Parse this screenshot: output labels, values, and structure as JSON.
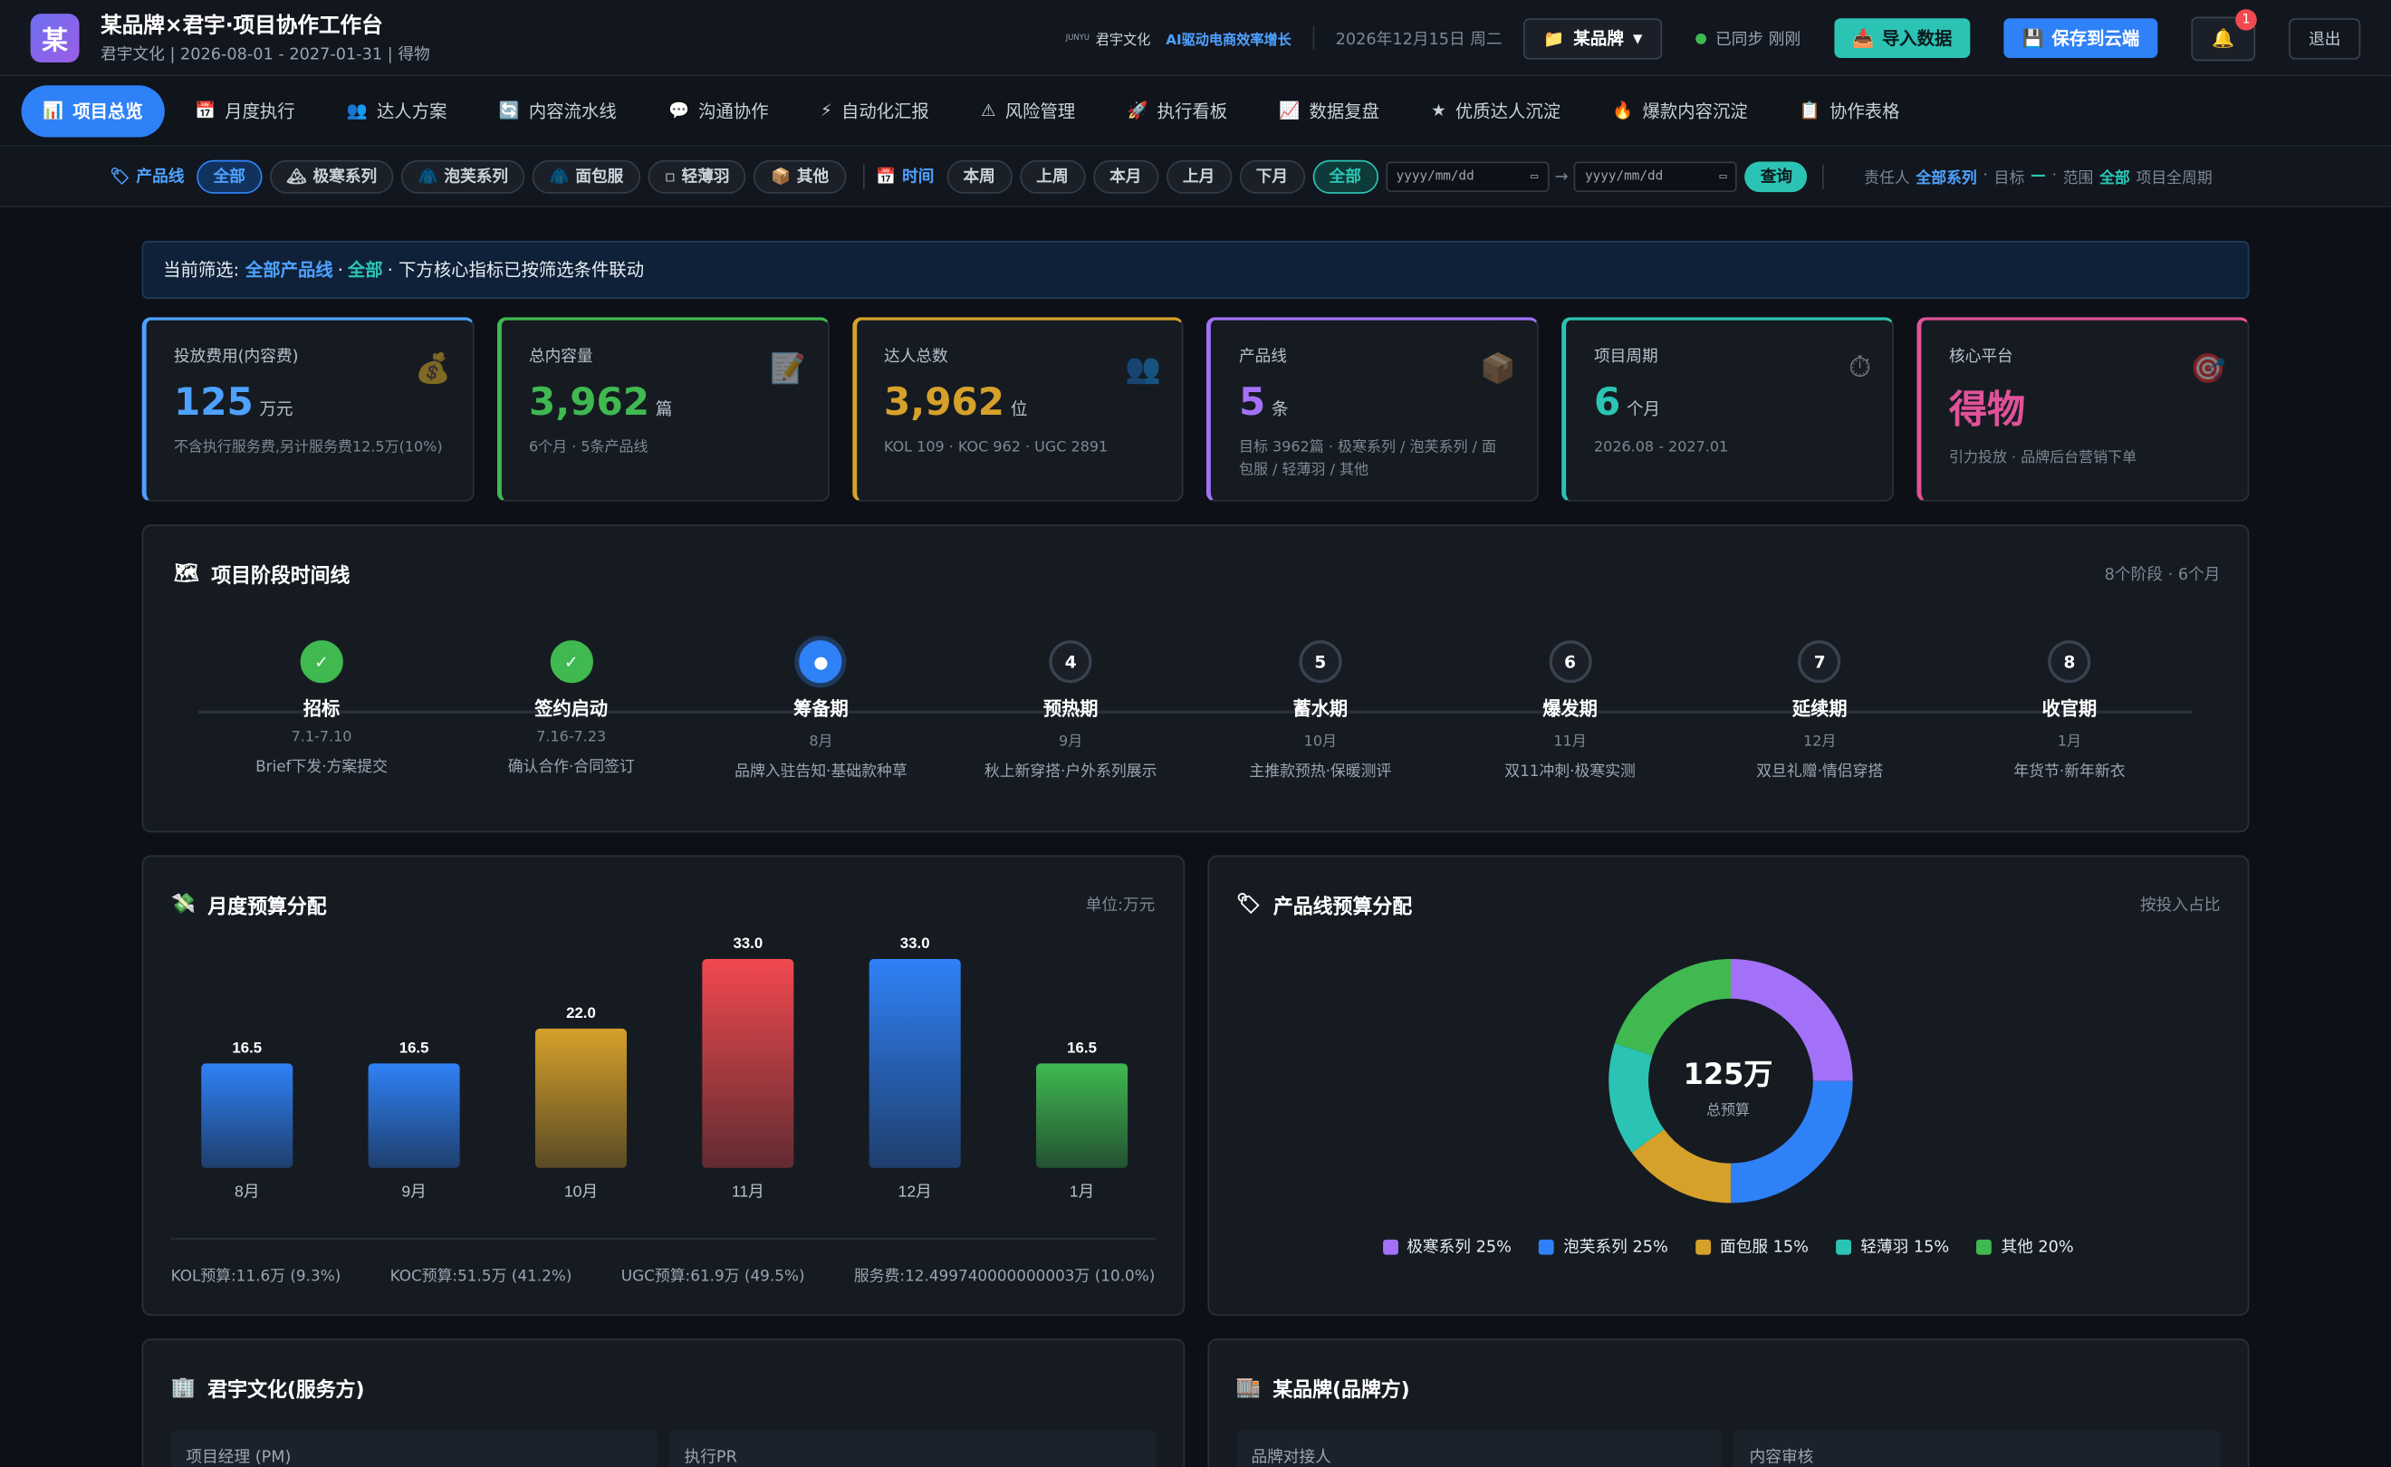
{
  "app": {
    "logo_char": "某",
    "title": "某品牌×君宇·项目协作工作台",
    "subtitle": "君宇文化 | 2026-08-01 - 2027-01-31 | 得物"
  },
  "topbar": {
    "brand_tiny": "JUNYU",
    "company": "君宇文化",
    "slogan": "AI驱动电商效率增长",
    "date": "2026年12月15日 周二",
    "brand_select": "某品牌",
    "sync_status": "已同步 刚刚",
    "import_label": "导入数据",
    "save_label": "保存到云端",
    "notif_count": "1",
    "logout_label": "退出"
  },
  "nav": {
    "items": [
      {
        "icon": "📊",
        "label": "项目总览"
      },
      {
        "icon": "📅",
        "label": "月度执行"
      },
      {
        "icon": "👥",
        "label": "达人方案"
      },
      {
        "icon": "🔄",
        "label": "内容流水线"
      },
      {
        "icon": "💬",
        "label": "沟通协作"
      },
      {
        "icon": "⚡",
        "label": "自动化汇报"
      },
      {
        "icon": "⚠",
        "label": "风险管理"
      },
      {
        "icon": "🚀",
        "label": "执行看板"
      },
      {
        "icon": "📈",
        "label": "数据复盘"
      },
      {
        "icon": "★",
        "label": "优质达人沉淀"
      },
      {
        "icon": "🔥",
        "label": "爆款内容沉淀"
      },
      {
        "icon": "📋",
        "label": "协作表格"
      }
    ]
  },
  "filters": {
    "product_label": "产品线",
    "product_chips": [
      {
        "icon": "",
        "label": "全部"
      },
      {
        "icon": "🏔",
        "label": "极寒系列"
      },
      {
        "icon": "🧥",
        "label": "泡芙系列"
      },
      {
        "icon": "🧥",
        "label": "面包服"
      },
      {
        "icon": "▫",
        "label": "轻薄羽"
      },
      {
        "icon": "📦",
        "label": "其他"
      }
    ],
    "time_label": "时间",
    "time_chips": [
      "本周",
      "上周",
      "本月",
      "上月",
      "下月",
      "全部"
    ],
    "date_placeholder": "yyyy/mm/dd",
    "date_arrow": "→",
    "query_label": "查询",
    "owner_label": "责任人",
    "owner_value": "全部系列",
    "target_label": "目标",
    "target_value": "—",
    "scope_label": "范围",
    "scope_value": "全部",
    "period_text": "项目全周期"
  },
  "notice": {
    "prefix": "当前筛选:",
    "product": "全部产品线",
    "dot1": "·",
    "time": "全部",
    "suffix": "· 下方核心指标已按筛选条件联动"
  },
  "kpis": [
    {
      "label": "投放费用(内容费)",
      "value": "125",
      "unit": "万元",
      "sub": "不含执行服务费,另计服务费12.5万(10%)",
      "icon": "💰",
      "color": "#4ea1ff"
    },
    {
      "label": "总内容量",
      "value": "3,962",
      "unit": "篇",
      "sub": "6个月 · 5条产品线",
      "icon": "📝",
      "color": "#3fb950"
    },
    {
      "label": "达人总数",
      "value": "3,962",
      "unit": "位",
      "sub": "KOL 109 · KOC 962 · UGC 2891",
      "icon": "👥",
      "color": "#d6a12a"
    },
    {
      "label": "产品线",
      "value": "5",
      "unit": "条",
      "sub": "目标 3962篇 · 极寒系列 / 泡芙系列 / 面包服 / 轻薄羽 / 其他",
      "icon": "📦",
      "color": "#a371f7"
    },
    {
      "label": "项目周期",
      "value": "6",
      "unit": "个月",
      "sub": "2026.08 - 2027.01",
      "icon": "⏱",
      "color": "#2bc4b4"
    },
    {
      "label": "核心平台",
      "value": "得物",
      "unit": "",
      "sub": "引力投放 · 品牌后台营销下单",
      "icon": "🎯",
      "color": "#e05299"
    }
  ],
  "timeline": {
    "icon": "🗺",
    "title": "项目阶段时间线",
    "meta": "8个阶段 · 6个月",
    "stages": [
      {
        "mark": "✓",
        "name": "招标",
        "date": "7.1-7.10",
        "desc": "Brief下发·方案提交",
        "state": "done"
      },
      {
        "mark": "✓",
        "name": "签约启动",
        "date": "7.16-7.23",
        "desc": "确认合作·合同签订",
        "state": "done"
      },
      {
        "mark": "●",
        "name": "筹备期",
        "date": "8月",
        "desc": "品牌入驻告知·基础款种草",
        "state": "cur"
      },
      {
        "mark": "4",
        "name": "预热期",
        "date": "9月",
        "desc": "秋上新穿搭·户外系列展示",
        "state": "todo"
      },
      {
        "mark": "5",
        "name": "蓄水期",
        "date": "10月",
        "desc": "主推款预热·保暖测评",
        "state": "todo"
      },
      {
        "mark": "6",
        "name": "爆发期",
        "date": "11月",
        "desc": "双11冲刺·极寒实测",
        "state": "todo"
      },
      {
        "mark": "7",
        "name": "延续期",
        "date": "12月",
        "desc": "双旦礼赠·情侣穿搭",
        "state": "todo"
      },
      {
        "mark": "8",
        "name": "收官期",
        "date": "1月",
        "desc": "年货节·新年新衣",
        "state": "todo"
      }
    ]
  },
  "monthly": {
    "icon": "💸",
    "title": "月度预算分配",
    "unit_label": "单位:万元",
    "footer": [
      "KOL预算:11.6万 (9.3%)",
      "KOC预算:51.5万 (41.2%)",
      "UGC预算:61.9万 (49.5%)",
      "服务费:12.499740000000003万 (10.0%)"
    ]
  },
  "productline": {
    "icon": "🏷",
    "title": "产品线预算分配",
    "meta": "按投入占比",
    "center_value": "125万",
    "center_label": "总预算"
  },
  "chart_data": [
    {
      "type": "bar",
      "categories": [
        "8月",
        "9月",
        "10月",
        "11月",
        "12月",
        "1月"
      ],
      "values": [
        16.5,
        16.5,
        22.0,
        33.0,
        33.0,
        16.5
      ],
      "colors": [
        "#2f81f7",
        "#2f81f7",
        "#d6a12a",
        "#f0494f",
        "#2f81f7",
        "#3fb950"
      ],
      "title": "月度预算分配",
      "ylabel": "",
      "ylim": [
        0,
        33
      ]
    },
    {
      "type": "pie",
      "categories": [
        "极寒系列",
        "泡芙系列",
        "面包服",
        "轻薄羽",
        "其他"
      ],
      "values": [
        25,
        25,
        15,
        15,
        20
      ],
      "colors": [
        "#a371f7",
        "#2f81f7",
        "#d6a12a",
        "#2bc4b4",
        "#3fb950"
      ],
      "legend": [
        "极寒系列 25%",
        "泡芙系列 25%",
        "面包服 15%",
        "轻薄羽 15%",
        "其他 20%"
      ],
      "title": "产品线预算分配"
    }
  ],
  "parties": [
    {
      "icon": "🏢",
      "title": "君宇文化(服务方)",
      "fields": [
        "项目经理 (PM)",
        "执行PR"
      ]
    },
    {
      "icon": "🏬",
      "title": "某品牌(品牌方)",
      "fields": [
        "品牌对接人",
        "内容审核"
      ]
    }
  ]
}
